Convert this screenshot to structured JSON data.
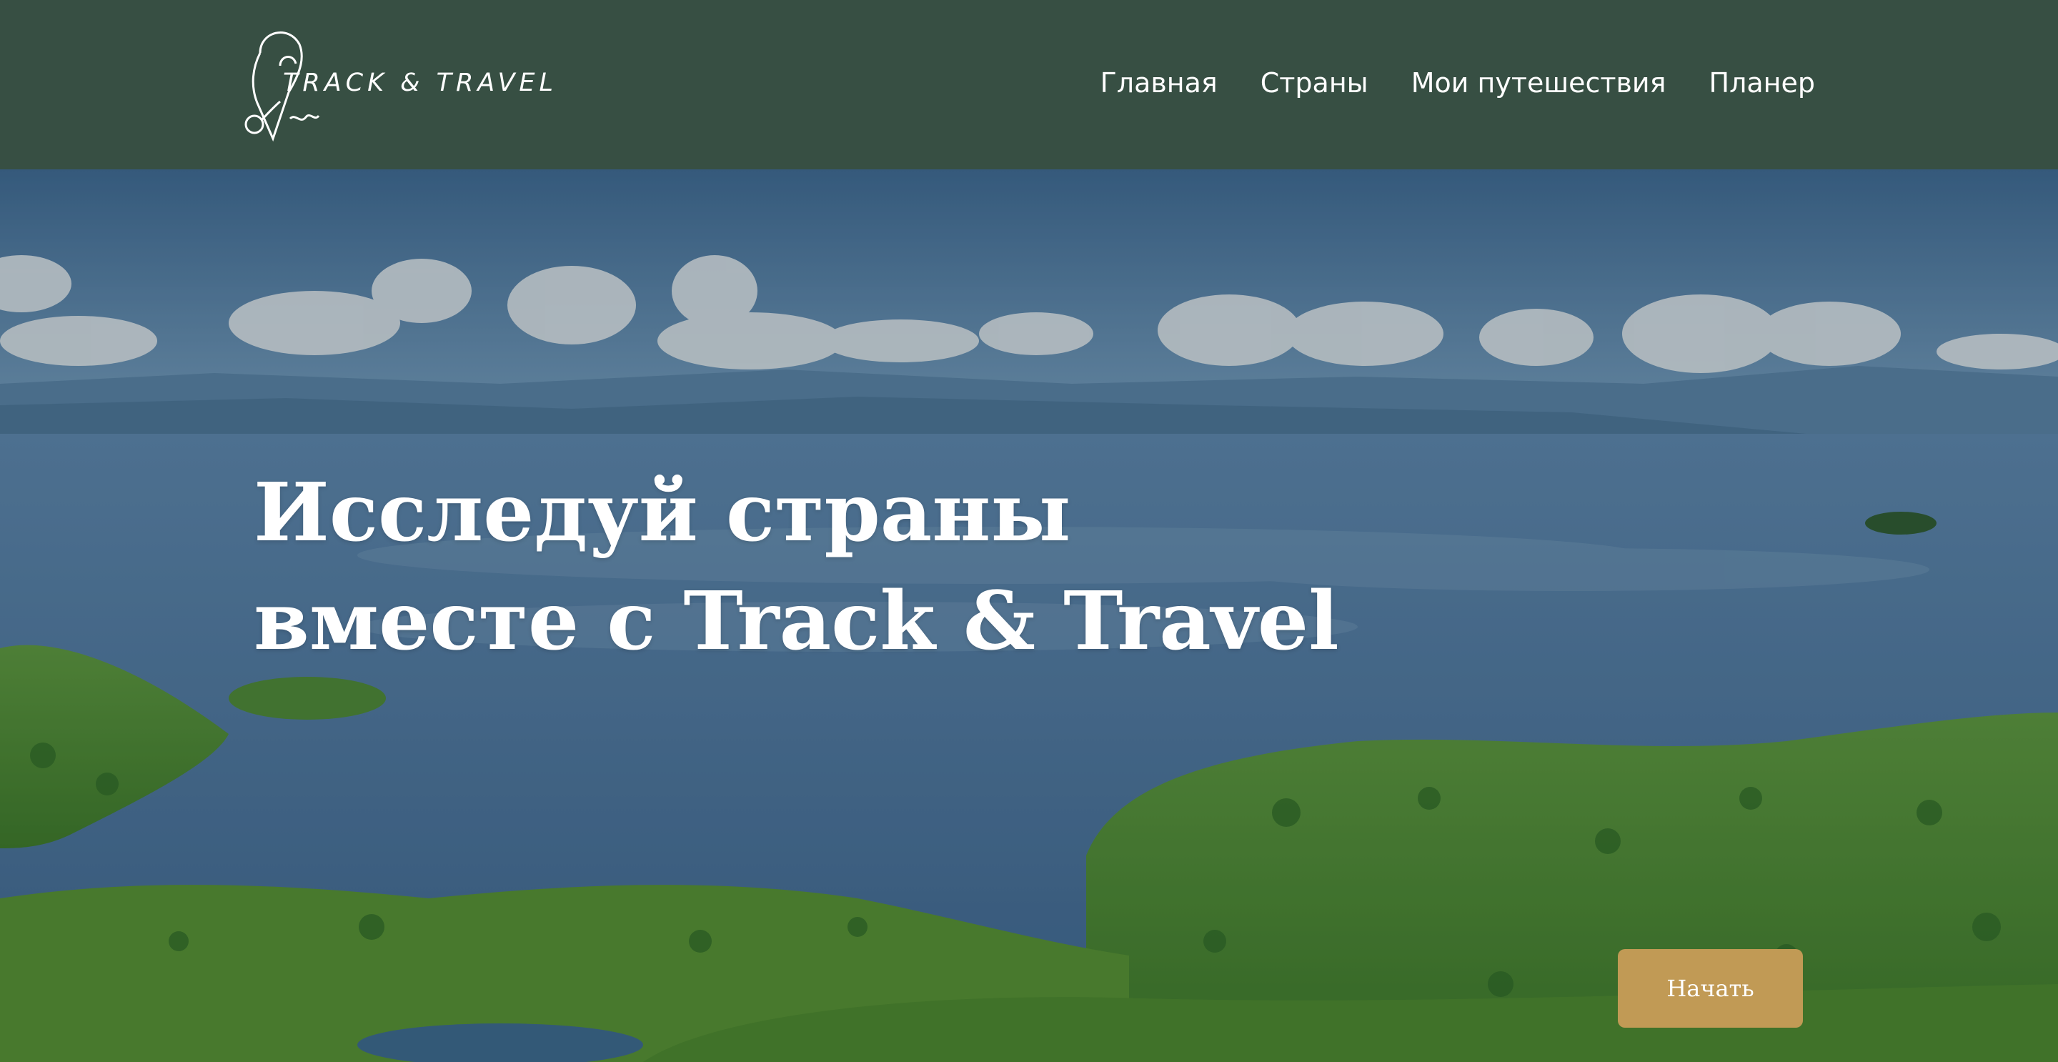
{
  "brand": {
    "logo_text": "TRACK & TRAVEL"
  },
  "nav": {
    "items": [
      {
        "label": "Главная"
      },
      {
        "label": "Страны"
      },
      {
        "label": "Мои путешествия"
      },
      {
        "label": "Планер"
      }
    ]
  },
  "hero": {
    "title_line1": "Исследуй страны",
    "title_line2": "вместе с Track & Travel",
    "cta_label": "Начать"
  },
  "colors": {
    "header_bg": "#374f43",
    "accent_button": "#c19a55",
    "text": "#ffffff"
  }
}
